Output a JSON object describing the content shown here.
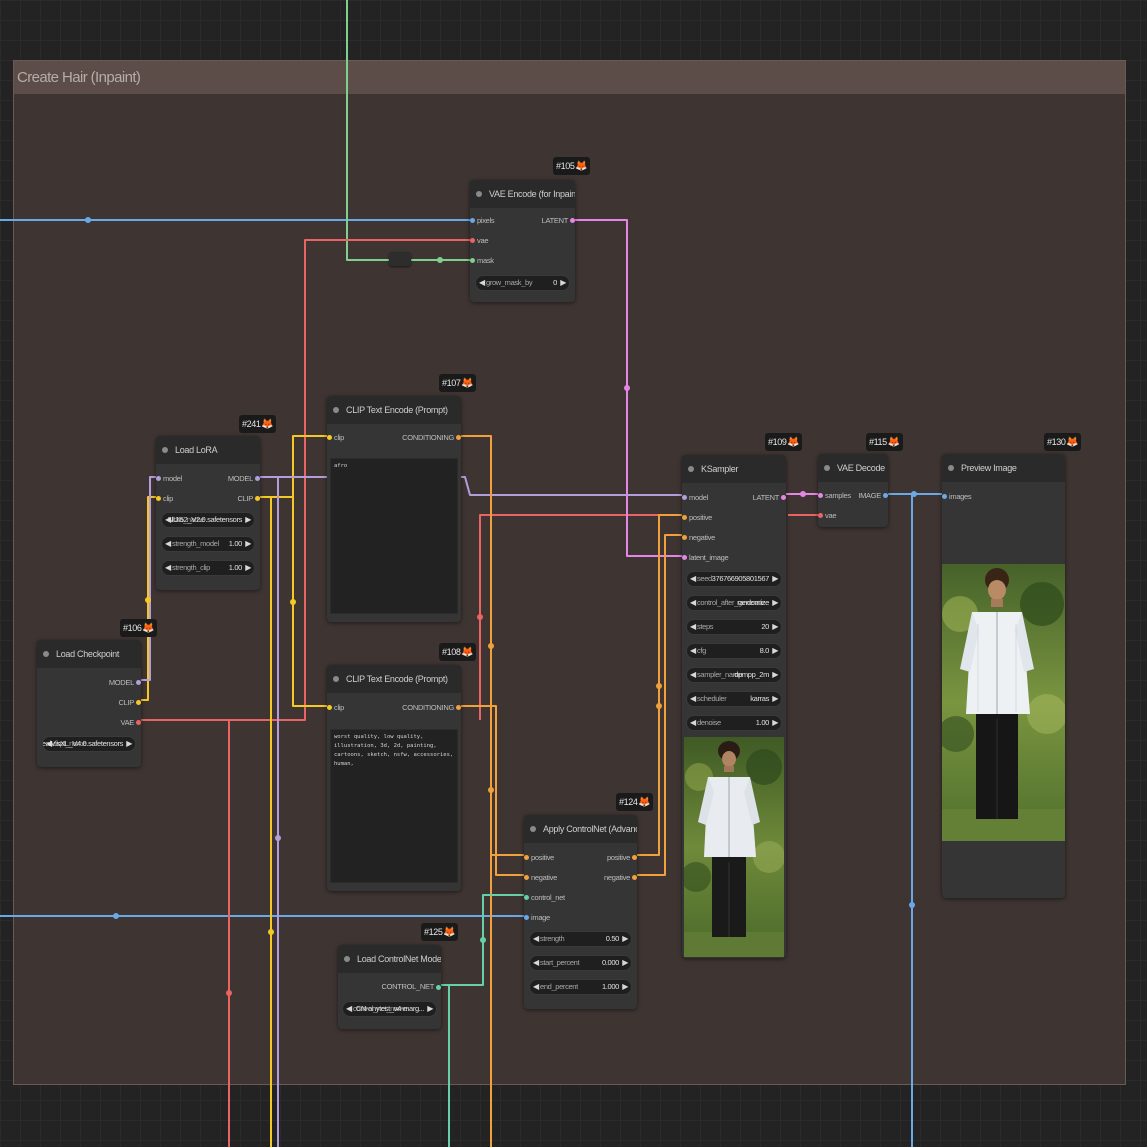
{
  "group": {
    "title": "Create Hair (Inpaint)"
  },
  "colors": {
    "image": "#6aa9e8",
    "vae": "#ea6464",
    "mask": "#7fcf8e",
    "latent": "#e486e4",
    "clip": "#f5c826",
    "model": "#b39ddb",
    "conditioning": "#f0a03c",
    "control_net": "#67d0a8"
  },
  "nodes": {
    "vae_encode": {
      "id": "#105",
      "title": "VAE Encode (for Inpainting)",
      "inputs": [
        "pixels",
        "vae",
        "mask"
      ],
      "output": "LATENT",
      "widget": {
        "name": "grow_mask_by",
        "value": "0"
      }
    },
    "clip_pos": {
      "id": "#107",
      "title": "CLIP Text Encode (Prompt)",
      "input": "clip",
      "output": "CONDITIONING",
      "text": "afro"
    },
    "clip_neg": {
      "id": "#108",
      "title": "CLIP Text Encode (Prompt)",
      "input": "clip",
      "output": "CONDITIONING",
      "text": "worst quality, low quality, illustration, 3d, 2d, painting, cartoons, sketch, nsfw, accessories, human,"
    },
    "lora": {
      "id": "#241",
      "title": "Load LoRA",
      "inputs": [
        "model",
        "clip"
      ],
      "outputs": [
        "MODEL",
        "CLIP"
      ],
      "widgets": [
        {
          "name": "lora_name",
          "value": "NIJI52_V2.0.safetensors"
        },
        {
          "name": "strength_model",
          "value": "1.00"
        },
        {
          "name": "strength_clip",
          "value": "1.00"
        }
      ]
    },
    "checkpoint": {
      "id": "#106",
      "title": "Load Checkpoint",
      "outputs": [
        "MODEL",
        "CLIP",
        "VAE"
      ],
      "widget": {
        "name": "ckpt_name",
        "value": "RealVisXL_V4.0.safetensors"
      }
    },
    "ksampler": {
      "id": "#109",
      "title": "KSampler",
      "inputs": [
        "model",
        "positive",
        "negative",
        "latent_image"
      ],
      "output": "LATENT",
      "widgets": [
        {
          "name": "seed",
          "value": "376766905801567"
        },
        {
          "name": "control_after_generate",
          "value": "randomize"
        },
        {
          "name": "steps",
          "value": "20"
        },
        {
          "name": "cfg",
          "value": "8.0"
        },
        {
          "name": "sampler_name",
          "value": "dpmpp_2m"
        },
        {
          "name": "scheduler",
          "value": "karras"
        },
        {
          "name": "denoise",
          "value": "1.00"
        }
      ]
    },
    "vae_decode": {
      "id": "#115",
      "title": "VAE Decode",
      "inputs": [
        "samples",
        "vae"
      ],
      "output": "IMAGE"
    },
    "preview": {
      "id": "#130",
      "title": "Preview Image",
      "input": "images"
    },
    "controlnet_apply": {
      "id": "#124",
      "title": "Apply ControlNet (Advanced)",
      "inputs": [
        "positive",
        "negative",
        "control_net",
        "image"
      ],
      "outputs": [
        "positive",
        "negative"
      ],
      "widgets": [
        {
          "name": "strength",
          "value": "0.50"
        },
        {
          "name": "start_percent",
          "value": "0.000"
        },
        {
          "name": "end_percent",
          "value": "1.000"
        }
      ]
    },
    "controlnet_load": {
      "id": "#125",
      "title": "Load ControlNet Model",
      "output": "CONTROL_NET",
      "widget": {
        "name": "control_net_name",
        "value": "CN-anytest_v4-marg..."
      }
    }
  }
}
